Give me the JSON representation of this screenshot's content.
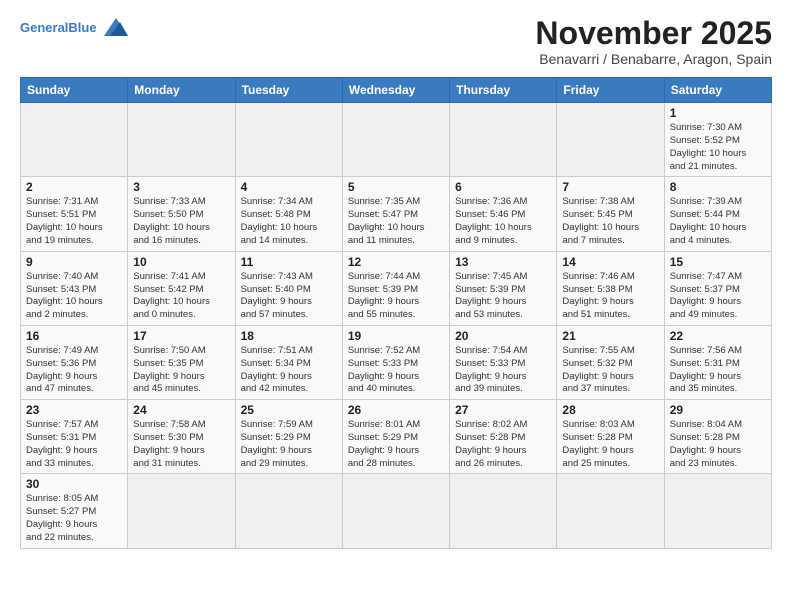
{
  "header": {
    "logo_general": "General",
    "logo_blue": "Blue",
    "title": "November 2025",
    "location": "Benavarri / Benabarre, Aragon, Spain"
  },
  "weekdays": [
    "Sunday",
    "Monday",
    "Tuesday",
    "Wednesday",
    "Thursday",
    "Friday",
    "Saturday"
  ],
  "weeks": [
    [
      {
        "day": "",
        "info": ""
      },
      {
        "day": "",
        "info": ""
      },
      {
        "day": "",
        "info": ""
      },
      {
        "day": "",
        "info": ""
      },
      {
        "day": "",
        "info": ""
      },
      {
        "day": "",
        "info": ""
      },
      {
        "day": "1",
        "info": "Sunrise: 7:30 AM\nSunset: 5:52 PM\nDaylight: 10 hours\nand 21 minutes."
      }
    ],
    [
      {
        "day": "2",
        "info": "Sunrise: 7:31 AM\nSunset: 5:51 PM\nDaylight: 10 hours\nand 19 minutes."
      },
      {
        "day": "3",
        "info": "Sunrise: 7:33 AM\nSunset: 5:50 PM\nDaylight: 10 hours\nand 16 minutes."
      },
      {
        "day": "4",
        "info": "Sunrise: 7:34 AM\nSunset: 5:48 PM\nDaylight: 10 hours\nand 14 minutes."
      },
      {
        "day": "5",
        "info": "Sunrise: 7:35 AM\nSunset: 5:47 PM\nDaylight: 10 hours\nand 11 minutes."
      },
      {
        "day": "6",
        "info": "Sunrise: 7:36 AM\nSunset: 5:46 PM\nDaylight: 10 hours\nand 9 minutes."
      },
      {
        "day": "7",
        "info": "Sunrise: 7:38 AM\nSunset: 5:45 PM\nDaylight: 10 hours\nand 7 minutes."
      },
      {
        "day": "8",
        "info": "Sunrise: 7:39 AM\nSunset: 5:44 PM\nDaylight: 10 hours\nand 4 minutes."
      }
    ],
    [
      {
        "day": "9",
        "info": "Sunrise: 7:40 AM\nSunset: 5:43 PM\nDaylight: 10 hours\nand 2 minutes."
      },
      {
        "day": "10",
        "info": "Sunrise: 7:41 AM\nSunset: 5:42 PM\nDaylight: 10 hours\nand 0 minutes."
      },
      {
        "day": "11",
        "info": "Sunrise: 7:43 AM\nSunset: 5:40 PM\nDaylight: 9 hours\nand 57 minutes."
      },
      {
        "day": "12",
        "info": "Sunrise: 7:44 AM\nSunset: 5:39 PM\nDaylight: 9 hours\nand 55 minutes."
      },
      {
        "day": "13",
        "info": "Sunrise: 7:45 AM\nSunset: 5:39 PM\nDaylight: 9 hours\nand 53 minutes."
      },
      {
        "day": "14",
        "info": "Sunrise: 7:46 AM\nSunset: 5:38 PM\nDaylight: 9 hours\nand 51 minutes."
      },
      {
        "day": "15",
        "info": "Sunrise: 7:47 AM\nSunset: 5:37 PM\nDaylight: 9 hours\nand 49 minutes."
      }
    ],
    [
      {
        "day": "16",
        "info": "Sunrise: 7:49 AM\nSunset: 5:36 PM\nDaylight: 9 hours\nand 47 minutes."
      },
      {
        "day": "17",
        "info": "Sunrise: 7:50 AM\nSunset: 5:35 PM\nDaylight: 9 hours\nand 45 minutes."
      },
      {
        "day": "18",
        "info": "Sunrise: 7:51 AM\nSunset: 5:34 PM\nDaylight: 9 hours\nand 42 minutes."
      },
      {
        "day": "19",
        "info": "Sunrise: 7:52 AM\nSunset: 5:33 PM\nDaylight: 9 hours\nand 40 minutes."
      },
      {
        "day": "20",
        "info": "Sunrise: 7:54 AM\nSunset: 5:33 PM\nDaylight: 9 hours\nand 39 minutes."
      },
      {
        "day": "21",
        "info": "Sunrise: 7:55 AM\nSunset: 5:32 PM\nDaylight: 9 hours\nand 37 minutes."
      },
      {
        "day": "22",
        "info": "Sunrise: 7:56 AM\nSunset: 5:31 PM\nDaylight: 9 hours\nand 35 minutes."
      }
    ],
    [
      {
        "day": "23",
        "info": "Sunrise: 7:57 AM\nSunset: 5:31 PM\nDaylight: 9 hours\nand 33 minutes."
      },
      {
        "day": "24",
        "info": "Sunrise: 7:58 AM\nSunset: 5:30 PM\nDaylight: 9 hours\nand 31 minutes."
      },
      {
        "day": "25",
        "info": "Sunrise: 7:59 AM\nSunset: 5:29 PM\nDaylight: 9 hours\nand 29 minutes."
      },
      {
        "day": "26",
        "info": "Sunrise: 8:01 AM\nSunset: 5:29 PM\nDaylight: 9 hours\nand 28 minutes."
      },
      {
        "day": "27",
        "info": "Sunrise: 8:02 AM\nSunset: 5:28 PM\nDaylight: 9 hours\nand 26 minutes."
      },
      {
        "day": "28",
        "info": "Sunrise: 8:03 AM\nSunset: 5:28 PM\nDaylight: 9 hours\nand 25 minutes."
      },
      {
        "day": "29",
        "info": "Sunrise: 8:04 AM\nSunset: 5:28 PM\nDaylight: 9 hours\nand 23 minutes."
      }
    ],
    [
      {
        "day": "30",
        "info": "Sunrise: 8:05 AM\nSunset: 5:27 PM\nDaylight: 9 hours\nand 22 minutes."
      },
      {
        "day": "",
        "info": ""
      },
      {
        "day": "",
        "info": ""
      },
      {
        "day": "",
        "info": ""
      },
      {
        "day": "",
        "info": ""
      },
      {
        "day": "",
        "info": ""
      },
      {
        "day": "",
        "info": ""
      }
    ]
  ]
}
